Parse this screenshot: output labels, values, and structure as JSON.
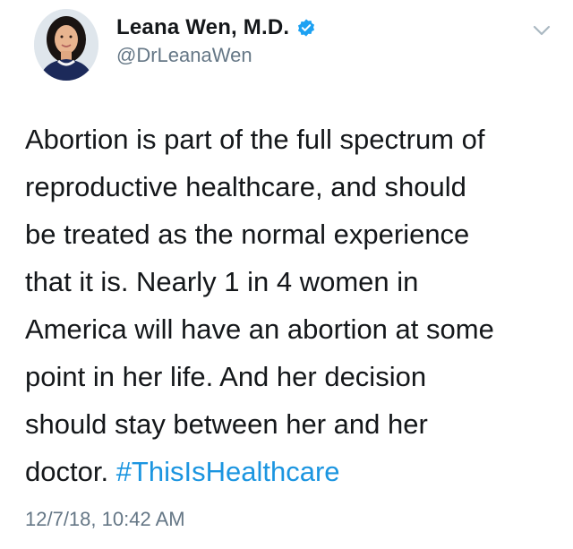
{
  "author": {
    "display_name": "Leana Wen, M.D.",
    "handle": "@DrLeanaWen",
    "verified": true,
    "avatar_icon": "profile-photo"
  },
  "menu": {
    "icon": "chevron-down-icon"
  },
  "tweet": {
    "lines": [
      "Abortion is part of the full spectrum of",
      "reproductive healthcare, and should",
      "be treated as the normal experience",
      "that it is. Nearly 1 in 4 women in",
      "America will have an abortion at some",
      "point in her life. And her decision",
      "should stay between her and her"
    ],
    "last_line_text": "doctor.",
    "hashtag": "#ThisIsHealthcare",
    "timestamp": "12/7/18, 10:42 AM"
  },
  "colors": {
    "text": "#14171a",
    "secondary": "#657786",
    "link": "#1b95e0",
    "verified_badge": "#1da1f2"
  }
}
